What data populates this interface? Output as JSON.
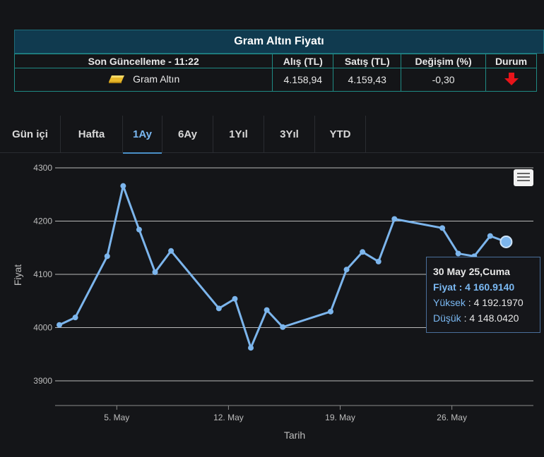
{
  "price_table": {
    "title": "Gram Altın Fiyatı",
    "headers": [
      "Son Güncelleme - 11:22",
      "Alış (TL)",
      "Satış (TL)",
      "Değişim (%)",
      "Durum"
    ],
    "row": {
      "icon": "gold-bar-icon",
      "name": "Gram Altın",
      "buy": "4.158,94",
      "sell": "4.159,43",
      "change": "-0,30",
      "status_icon": "arrow-down-icon",
      "status_color": "#e8141a"
    }
  },
  "tabs": [
    {
      "label": "Gün içi",
      "active": false
    },
    {
      "label": "Hafta",
      "active": false
    },
    {
      "label": "1Ay",
      "active": true
    },
    {
      "label": "6Ay",
      "active": false
    },
    {
      "label": "1Yıl",
      "active": false
    },
    {
      "label": "3Yıl",
      "active": false
    },
    {
      "label": "YTD",
      "active": false
    }
  ],
  "chart_data": {
    "type": "line",
    "xlabel": "Tarih",
    "ylabel": "Fiyat",
    "ylim": [
      3900,
      4300
    ],
    "yticks": [
      "3900",
      "4000",
      "4100",
      "4200",
      "4300"
    ],
    "xtick_labels": [
      "5. May",
      "12. May",
      "19. May",
      "26. May"
    ],
    "xtick_days": [
      5,
      12,
      19,
      26
    ],
    "xlim_days": [
      1.4,
      31.1
    ],
    "grid": true,
    "line_color": "#7cb5ec",
    "series": [
      {
        "x": [
          1.4,
          2.4,
          4.4,
          5.4,
          6.4,
          7.4,
          8.4,
          11.4,
          12.4,
          13.4,
          14.4,
          15.4,
          18.4,
          19.4,
          20.4,
          21.4,
          22.4,
          25.4,
          26.4,
          27.4,
          28.4,
          29.4
        ],
        "y": [
          4005,
          4019,
          4134,
          4266,
          4184,
          4104,
          4144,
          4036,
          4054,
          3962,
          4033,
          4001,
          4030,
          4109,
          4142,
          4124,
          4204,
          4187,
          4139,
          4134,
          4172,
          4161
        ]
      }
    ],
    "tooltip": {
      "title": "30 May 25,Cuma",
      "price_label": "Fiyat",
      "price_value": "4 160.9140",
      "high_label": "Yüksek",
      "high_value": "4 192.1970",
      "low_label": "Düşük",
      "low_value": "4 148.0420"
    }
  }
}
